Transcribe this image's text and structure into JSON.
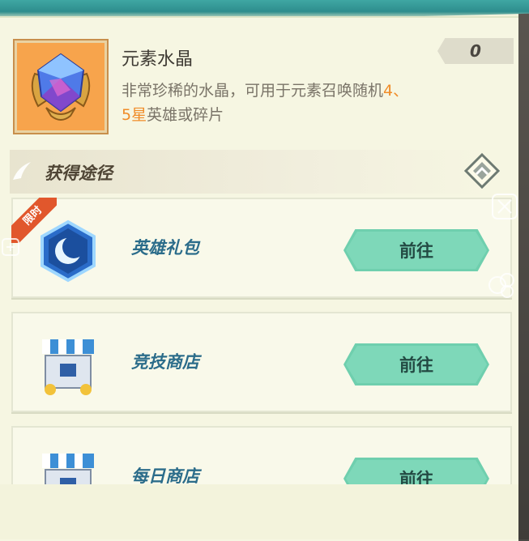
{
  "item": {
    "name": "元素水晶",
    "description_plain": "非常珍稀的水晶，可用于元素召唤随机",
    "description_hl1": "4、",
    "description_hl2": "5星",
    "description_tail": "英雄或碎片",
    "count": "0",
    "icon": "elemental-crystal-icon"
  },
  "section": {
    "title": "获得途径"
  },
  "sources": [
    {
      "label": "英雄礼包",
      "button": "前往",
      "badge": "限时",
      "icon": "hero-pack-moon-crystal-icon"
    },
    {
      "label": "竞技商店",
      "button": "前往",
      "icon": "shop-chest-icon"
    },
    {
      "label": "每日商店",
      "button": "前往",
      "icon": "shop-chest-icon"
    }
  ],
  "colors": {
    "accent_orange": "#f08c28",
    "button_green": "#7ed8b9",
    "label_blue": "#2b6c8a",
    "badge_red": "#e1572c"
  }
}
